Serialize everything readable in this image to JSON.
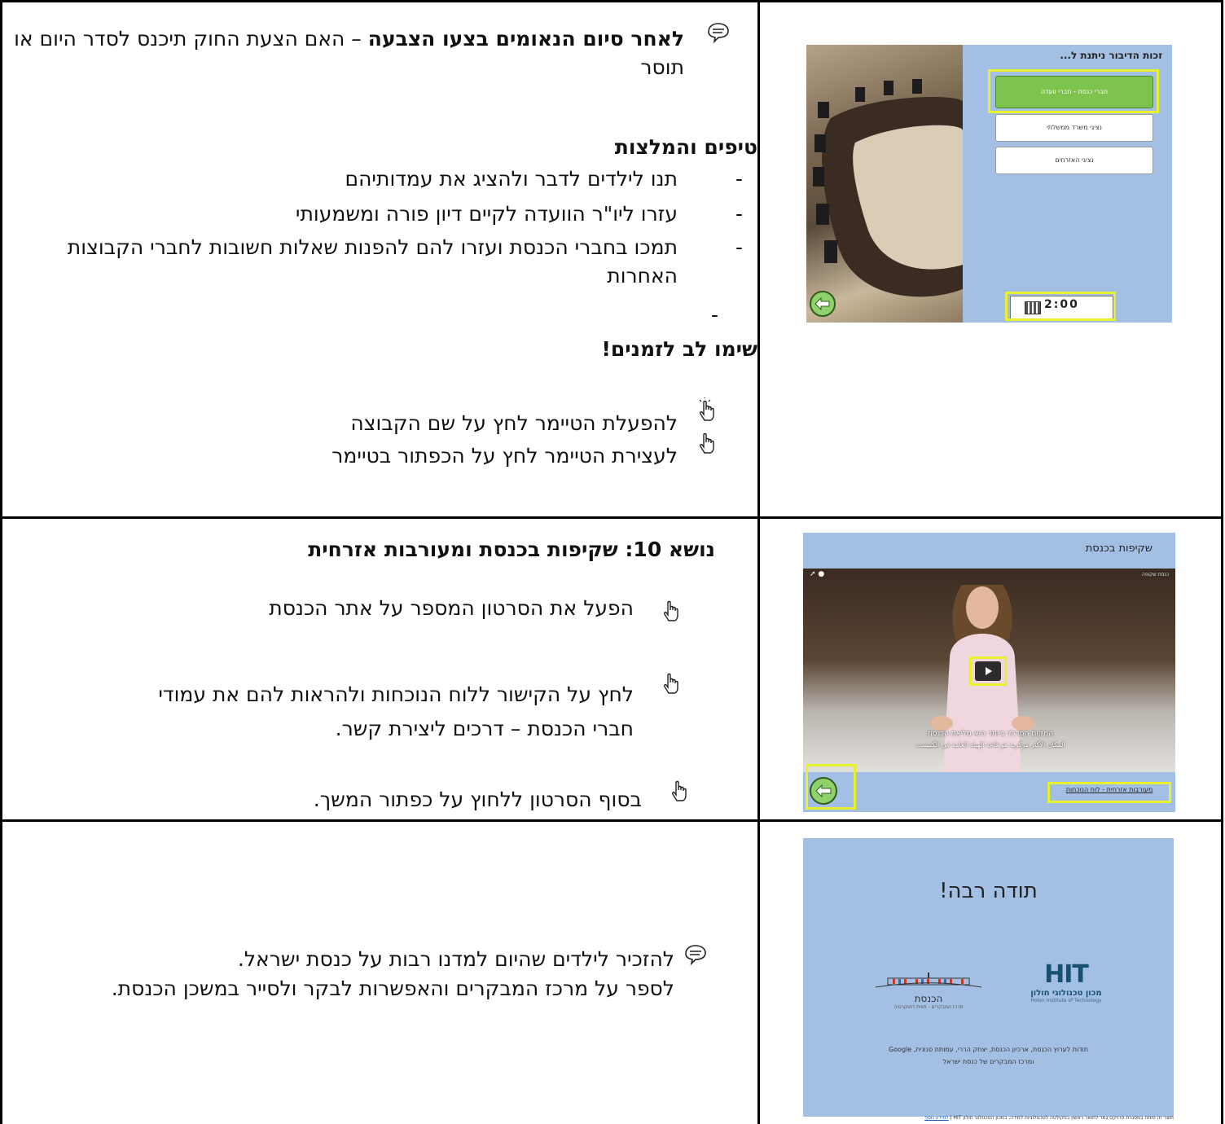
{
  "row1": {
    "tip_bold": "לאחר סיום הנאומים בצעו הצבעה",
    "tip_rest": " – האם הצעת החוק תיכנס לסדר היום או תוסר",
    "tips_heading": "טיפים והמלצות",
    "bullets": [
      "תנו לילדים לדבר ולהציג את עמדותיהם",
      "עזרו ליו\"ר הוועדה לקיים דיון פורה ומשמעותי",
      "תמכו בחברי הכנסת ועזרו להם להפנות שאלות חשובות לחברי הקבוצות האחרות"
    ],
    "bullet_mark": "-",
    "attention": "שימו לב לזמנים!",
    "timer_start": "להפעלת הטיימר לחץ על שם הקבוצה",
    "timer_stop": "לעצירת הטיימר לחץ על הכפתור בטיימר",
    "screen": {
      "title": "זכות הדיבור ניתנת ל...",
      "options": [
        "חברי כנסת - חברי וועדה",
        "נציגי משרד ממשלתי",
        "נציגי האזרחים"
      ],
      "timer": "2:00"
    }
  },
  "row2": {
    "heading": "נושא 10: שקיפות בכנסת ומעורבות אזרחית",
    "step1": "הפעל את הסרטון המספר על אתר הכנסת",
    "step2a": "לחץ על הקישור ללוח הנוכחות ולהראות להם את עמודי",
    "step2b": "חברי הכנסת – דרכים ליצירת קשר.",
    "step3": "בסוף הסרטון ללחוץ על כפתור המשך.",
    "screen": {
      "title": "שקיפות בכנסת",
      "video_tag": "כנסת שקופה",
      "subtitle1": "המקום המרכזי ביותר הוא מליאת הכנסת",
      "subtitle2": "المكان الأكثر مركزية هو قاعة الهيئة العامة في الكنيست",
      "link": "מעורבות אזרחית - לוח הנוכחות"
    }
  },
  "row3": {
    "line1": "להזכיר לילדים שהיום למדנו רבות על כנסת ישראל.",
    "line2": "לספר על מרכז המבקרים והאפשרות לבקר ולסייר במשכן הכנסת.",
    "screen": {
      "title": "תודה רבה!",
      "knesset_name": "הכנסת",
      "knesset_sub": "מרכז המבקרים - חווית דמוקרטיה",
      "hit_logo": "HIT",
      "hit_he": "מכון טכנולוגי חולון",
      "hit_en": "Holon Institute of Technology",
      "thanks1": "תודות לערוץ הכנסת, ארכיון הכנסת, יצחק הררי, עמותת סנונית, Google",
      "thanks2": "ומרכז המבקרים של כנסת ישראל",
      "footer": "תוצר זה פותח במסגרת פרויקט גמר לתואר ראשון בפקולטה לטכנולוגיות למידה, במכון הטכנולוגי חולון HIT",
      "footer_link": "למידע נוסף"
    }
  },
  "colors": {
    "slide_bg": "#a3bfe4",
    "highlight": "#e8f12b",
    "green": "#7dc34d"
  }
}
